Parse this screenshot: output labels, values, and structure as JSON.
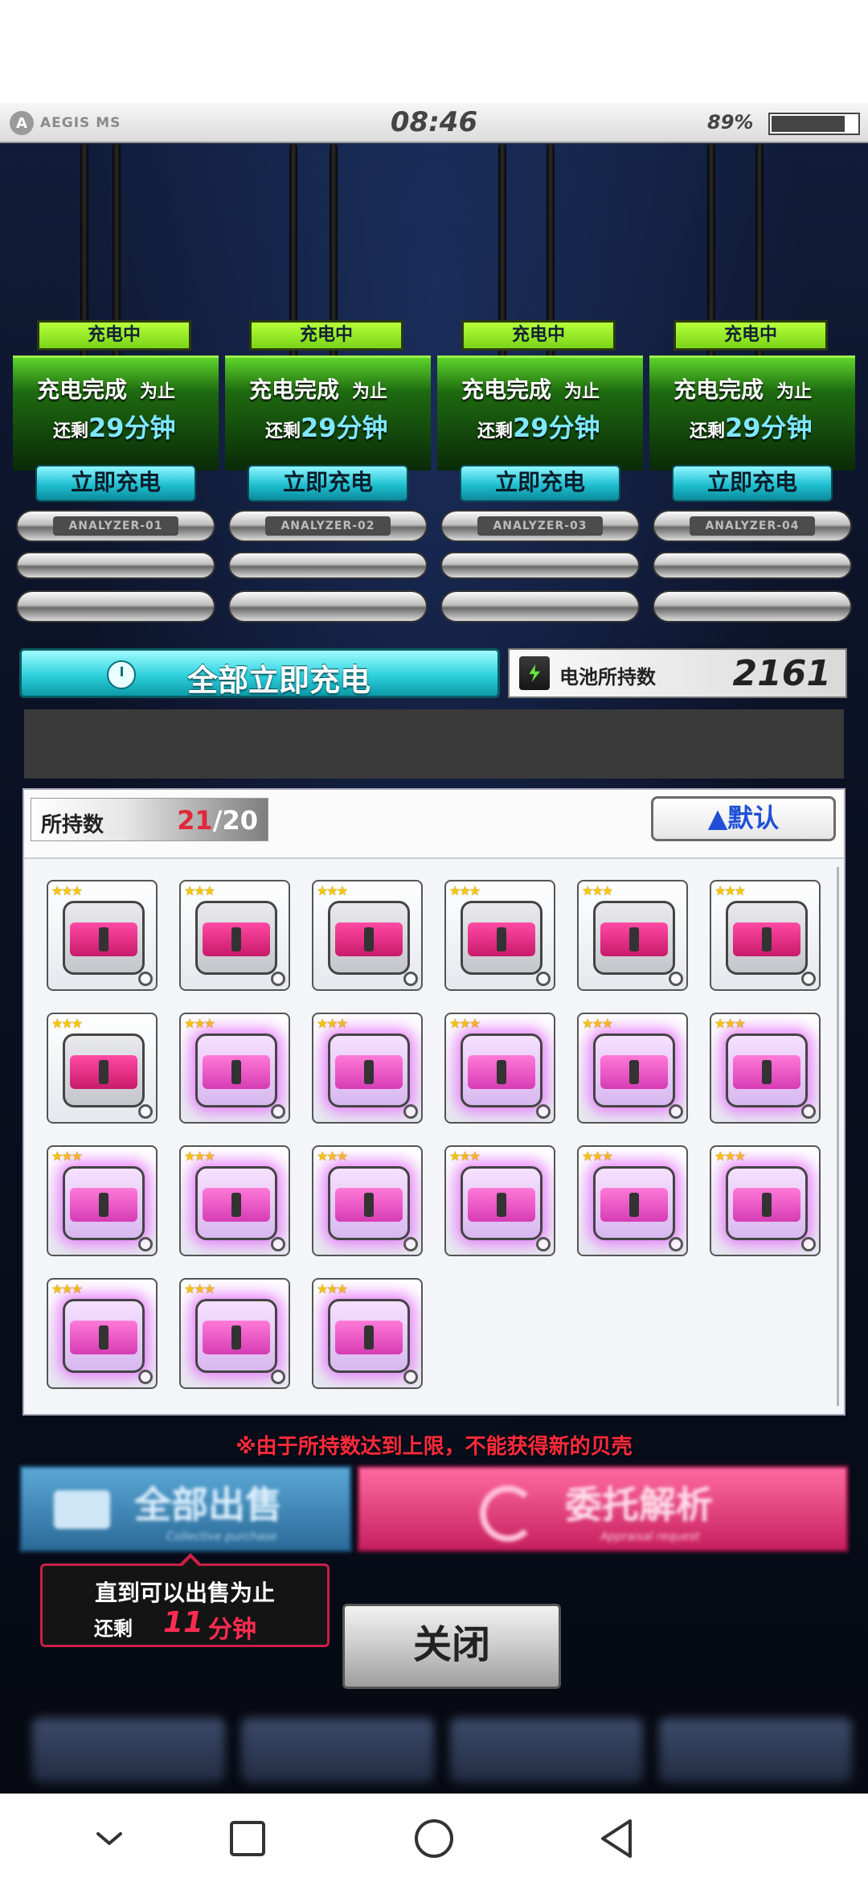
{
  "status_bar": {
    "logo_text": "AEGIS MS",
    "time": "08:46",
    "battery_percent": "89%",
    "battery_level": 0.89
  },
  "analyzers": [
    {
      "status": "充电中",
      "line1_main": "充电完成",
      "line1_suffix": "为止",
      "line2_prefix": "还剩",
      "line2_value": "29分钟",
      "button": "立即充电",
      "plate": "ANALYZER-01"
    },
    {
      "status": "充电中",
      "line1_main": "充电完成",
      "line1_suffix": "为止",
      "line2_prefix": "还剩",
      "line2_value": "29分钟",
      "button": "立即充电",
      "plate": "ANALYZER-02"
    },
    {
      "status": "充电中",
      "line1_main": "充电完成",
      "line1_suffix": "为止",
      "line2_prefix": "还剩",
      "line2_value": "29分钟",
      "button": "立即充电",
      "plate": "ANALYZER-03"
    },
    {
      "status": "充电中",
      "line1_main": "充电完成",
      "line1_suffix": "为止",
      "line2_prefix": "还剩",
      "line2_value": "29分钟",
      "button": "立即充电",
      "plate": "ANALYZER-04"
    }
  ],
  "charge_all": {
    "label": "全部立即充电"
  },
  "battery": {
    "label": "电池所持数",
    "value": "2161"
  },
  "inventory": {
    "owned_label": "所持数",
    "owned_current": "21",
    "owned_max": "/20",
    "sort_button": "▲默认",
    "items": [
      {
        "stars": "★★★",
        "kind": "pink"
      },
      {
        "stars": "★★★",
        "kind": "pink"
      },
      {
        "stars": "★★★",
        "kind": "pink"
      },
      {
        "stars": "★★★",
        "kind": "pink"
      },
      {
        "stars": "★★★",
        "kind": "pink"
      },
      {
        "stars": "★★★",
        "kind": "pink"
      },
      {
        "stars": "★★★",
        "kind": "pink"
      },
      {
        "stars": "★★★",
        "kind": "glow"
      },
      {
        "stars": "★★★",
        "kind": "glow"
      },
      {
        "stars": "★★★",
        "kind": "glow"
      },
      {
        "stars": "★★★",
        "kind": "glow"
      },
      {
        "stars": "★★★",
        "kind": "glow"
      },
      {
        "stars": "★★★",
        "kind": "glow"
      },
      {
        "stars": "★★★",
        "kind": "glow"
      },
      {
        "stars": "★★★",
        "kind": "glow"
      },
      {
        "stars": "★★★",
        "kind": "glow"
      },
      {
        "stars": "★★★",
        "kind": "glow"
      },
      {
        "stars": "★★★",
        "kind": "glow"
      },
      {
        "stars": "★★★",
        "kind": "glow"
      },
      {
        "stars": "★★★",
        "kind": "glow"
      },
      {
        "stars": "★★★",
        "kind": "glow"
      }
    ]
  },
  "warning": "※由于所持数达到上限，不能获得新的贝壳",
  "actions": {
    "sell_all": "全部出售",
    "sell_all_sub": "Collective purchase",
    "appraise": "委托解析",
    "appraise_sub": "Appraisal request"
  },
  "tooltip": {
    "line1": "直到可以出售为止",
    "prefix": "还剩",
    "minutes": "11",
    "unit": "分钟"
  },
  "close_button": "关闭",
  "colors": {
    "accent_green": "#8ee62c",
    "accent_cyan": "#2ed0dc",
    "warning_red": "#ff2b3c",
    "pink": "#d63cb4"
  },
  "nav_icons": [
    "chevron-down-icon",
    "recents-square-icon",
    "home-circle-icon",
    "back-triangle-icon"
  ]
}
